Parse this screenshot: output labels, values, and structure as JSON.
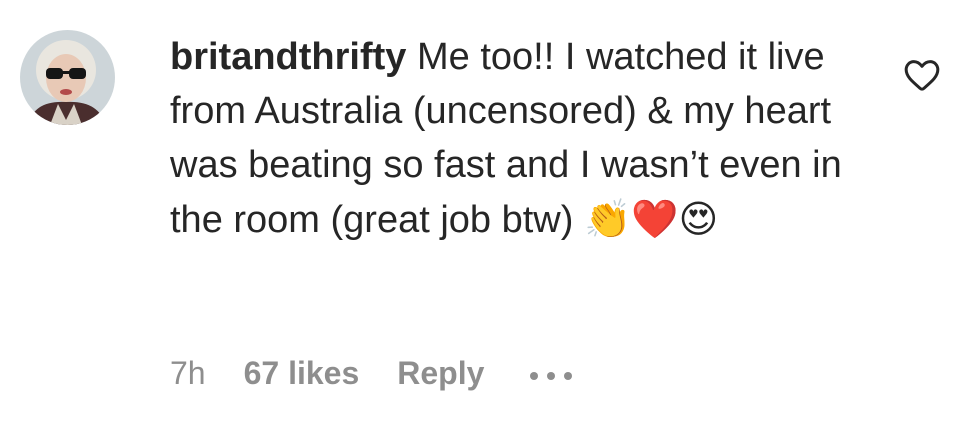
{
  "comment": {
    "username": "britandthrifty",
    "text": " Me too!! I watched it live from Australia (uncensored) & my heart was beating so fast and I wasn’t even in the room (great job btw) ",
    "emojis": "👏❤️😍",
    "time": "7h",
    "likes": "67 likes",
    "reply_label": "Reply",
    "icons": {
      "like": "heart-outline-icon",
      "more": "more-options-icon"
    },
    "colors": {
      "text": "#262626",
      "secondary": "#8e8e8e"
    }
  }
}
